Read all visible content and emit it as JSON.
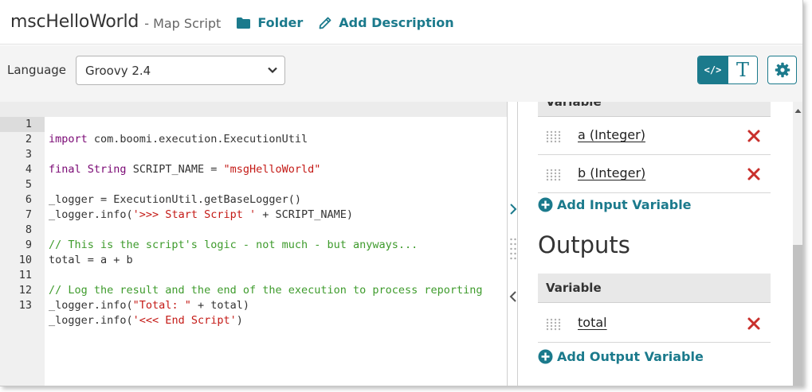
{
  "header": {
    "title": "mscHelloWorld",
    "subtitle": "- Map Script",
    "folder_label": "Folder",
    "add_description_label": "Add Description"
  },
  "language_bar": {
    "label": "Language",
    "selected": "Groovy 2.4",
    "code_view_glyph": "</>",
    "text_view_glyph": "T"
  },
  "editor": {
    "line_numbers": [
      "1",
      "2",
      "3",
      "4",
      "5",
      "6",
      "7",
      "8",
      "9",
      "10",
      "11",
      "12",
      "13"
    ],
    "lines": [
      "import com.boomi.execution.ExecutionUtil",
      "",
      "final String SCRIPT_NAME = \"msgHelloWorld\"",
      "",
      "_logger = ExecutionUtil.getBaseLogger()",
      "_logger.info('>>> Start Script ' + SCRIPT_NAME)",
      "",
      "// This is the script's logic - not much - but anyways...",
      "total = a + b",
      "",
      "// Log the result and the end of the execution to process reporting",
      "_logger.info(\"Total: \" + total)",
      "_logger.info('<<< End Script')"
    ],
    "active_line": 1
  },
  "inputs": {
    "column_header": "Variable",
    "variables": [
      "a (Integer)",
      "b (Integer)"
    ],
    "add_label": "Add Input Variable"
  },
  "outputs": {
    "title": "Outputs",
    "column_header": "Variable",
    "variables": [
      "total"
    ],
    "add_label": "Add Output Variable"
  },
  "colors": {
    "accent": "#1b7a8c",
    "delete": "#c9302c",
    "keyword": "#7a0874",
    "string": "#c41a16",
    "comment": "#3e9b2c"
  },
  "icons": {
    "folder": "folder-icon",
    "edit": "pencil-icon",
    "code": "code-icon",
    "text": "text-format-icon",
    "settings": "gear-icon",
    "delete": "close-icon",
    "add": "plus-circle-icon",
    "drag": "drag-handle-icon"
  }
}
